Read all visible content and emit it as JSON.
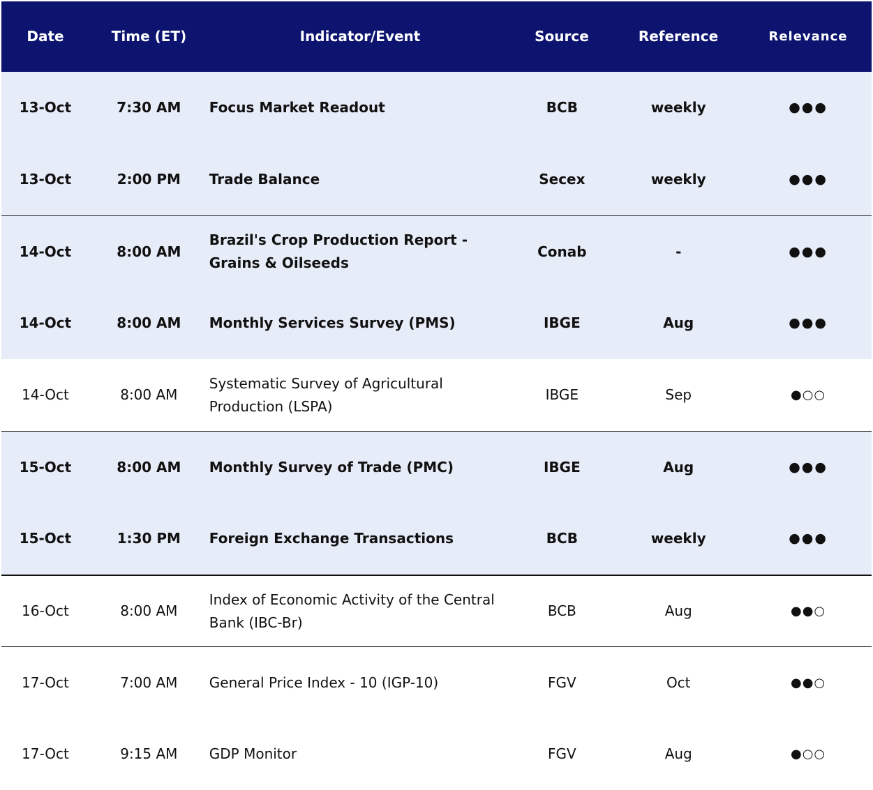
{
  "columns": [
    "Date",
    "Time (ET)",
    "Indicator/Event",
    "Source",
    "Reference",
    "Relevance"
  ],
  "rows": [
    {
      "date": "13-Oct",
      "time": "7:30 AM",
      "event": "Focus Market Readout",
      "source": "BCB",
      "reference": "weekly",
      "relevance": "●●●"
    },
    {
      "date": "13-Oct",
      "time": "2:00 PM",
      "event": "Trade Balance",
      "source": "Secex",
      "reference": "weekly",
      "relevance": "●●●"
    },
    {
      "date": "14-Oct",
      "time": "8:00 AM",
      "event": "Brazil's Crop Production Report - Grains & Oilseeds",
      "source": "Conab",
      "reference": "-",
      "relevance": "●●●"
    },
    {
      "date": "14-Oct",
      "time": "8:00 AM",
      "event": "Monthly Services Survey (PMS)",
      "source": "IBGE",
      "reference": "Aug",
      "relevance": "●●●"
    },
    {
      "date": "14-Oct",
      "time": "8:00 AM",
      "event": "Systematic Survey of Agricultural Production (LSPA)",
      "source": "IBGE",
      "reference": "Sep",
      "relevance": "●○○"
    },
    {
      "date": "15-Oct",
      "time": "8:00 AM",
      "event": "Monthly Survey of Trade (PMC)",
      "source": "IBGE",
      "reference": "Aug",
      "relevance": "●●●"
    },
    {
      "date": "15-Oct",
      "time": "1:30 PM",
      "event": "Foreign Exchange Transactions",
      "source": "BCB",
      "reference": "weekly",
      "relevance": "●●●"
    },
    {
      "date": "16-Oct",
      "time": "8:00 AM",
      "event": "Index of Economic Activity of the Central Bank (IBC-Br)",
      "source": "BCB",
      "reference": "Aug",
      "relevance": "●●○"
    },
    {
      "date": "17-Oct",
      "time": "7:00 AM",
      "event": "General Price Index - 10 (IGP-10)",
      "source": "FGV",
      "reference": "Oct",
      "relevance": "●●○"
    },
    {
      "date": "17-Oct",
      "time": "9:15 AM",
      "event": "GDP Monitor",
      "source": "FGV",
      "reference": "Aug",
      "relevance": "●○○"
    }
  ],
  "colors": {
    "header_bg": "#0c1470",
    "header_text": "#ffffff",
    "highlight_bg": "#e6ecf8",
    "text": "#111111"
  }
}
